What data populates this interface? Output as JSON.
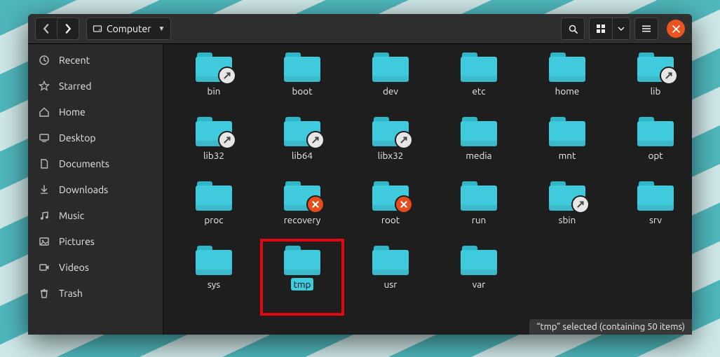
{
  "titlebar": {
    "path_icon": "disk-icon",
    "path_label": "Computer",
    "back_enabled": false,
    "fwd_enabled": true
  },
  "sidebar": {
    "items": [
      {
        "icon": "clock-icon",
        "label": "Recent"
      },
      {
        "icon": "star-icon",
        "label": "Starred"
      },
      {
        "icon": "home-icon",
        "label": "Home"
      },
      {
        "icon": "desktop-icon",
        "label": "Desktop"
      },
      {
        "icon": "file-icon",
        "label": "Documents"
      },
      {
        "icon": "download-icon",
        "label": "Downloads"
      },
      {
        "icon": "music-icon",
        "label": "Music"
      },
      {
        "icon": "image-icon",
        "label": "Pictures"
      },
      {
        "icon": "video-icon",
        "label": "Videos"
      },
      {
        "icon": "trash-icon",
        "label": "Trash"
      }
    ]
  },
  "folders": [
    {
      "name": "bin",
      "emblem": "link"
    },
    {
      "name": "boot",
      "emblem": null
    },
    {
      "name": "dev",
      "emblem": null
    },
    {
      "name": "etc",
      "emblem": null
    },
    {
      "name": "home",
      "emblem": null
    },
    {
      "name": "lib",
      "emblem": "link"
    },
    {
      "name": "lib32",
      "emblem": "link"
    },
    {
      "name": "lib64",
      "emblem": "link"
    },
    {
      "name": "libx32",
      "emblem": "link"
    },
    {
      "name": "media",
      "emblem": null
    },
    {
      "name": "mnt",
      "emblem": null
    },
    {
      "name": "opt",
      "emblem": null
    },
    {
      "name": "proc",
      "emblem": null
    },
    {
      "name": "recovery",
      "emblem": "denied"
    },
    {
      "name": "root",
      "emblem": "denied"
    },
    {
      "name": "run",
      "emblem": null
    },
    {
      "name": "sbin",
      "emblem": "link"
    },
    {
      "name": "srv",
      "emblem": null
    },
    {
      "name": "sys",
      "emblem": null
    },
    {
      "name": "tmp",
      "emblem": null,
      "selected": true
    },
    {
      "name": "usr",
      "emblem": null
    },
    {
      "name": "var",
      "emblem": null
    }
  ],
  "status": "“tmp” selected  (containing 50 items)"
}
